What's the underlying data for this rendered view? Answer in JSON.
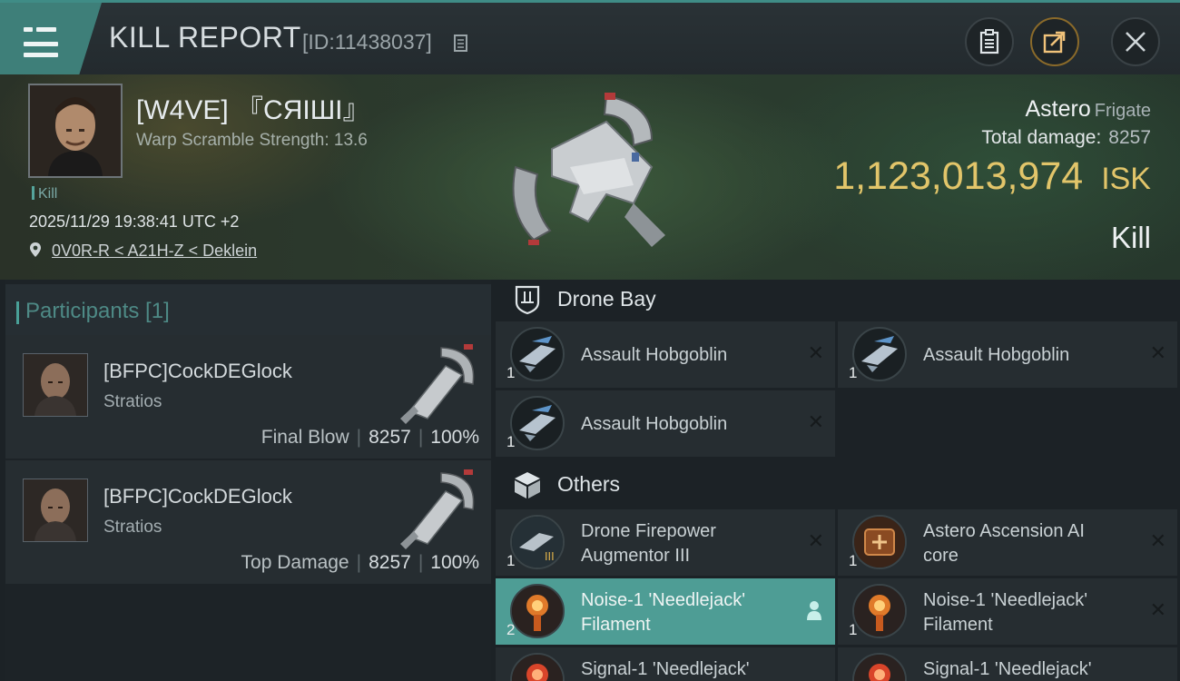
{
  "header": {
    "title": "KILL REPORT",
    "report_id": "[ID:11438037]",
    "icons": [
      "menu-icon",
      "copy-icon",
      "clipboard-icon",
      "share-icon",
      "close-icon"
    ]
  },
  "victim": {
    "pilot_name": "[W4VE] 『CЯIШI』",
    "warp_scramble": "Warp Scramble Strength: 13.6",
    "kill_tag": "Kill",
    "datetime": "2025/11/29 19:38:41 UTC +2",
    "location": "0V0R-R < A21H-Z < Deklein",
    "ship_name": "Astero",
    "ship_class": "Frigate",
    "total_damage_label": "Total damage:",
    "total_damage_value": "8257",
    "isk_value": "1,123,013,974",
    "isk_unit": "ISK",
    "result": "Kill"
  },
  "participants": {
    "label": "Participants [1]",
    "rows": [
      {
        "name": "[BFPC]CockDEGlock",
        "ship": "Stratios",
        "role": "Final Blow",
        "damage": "8257",
        "percent": "100%"
      },
      {
        "name": "[BFPC]CockDEGlock",
        "ship": "Stratios",
        "role": "Top Damage",
        "damage": "8257",
        "percent": "100%"
      }
    ]
  },
  "drone_bay": {
    "label": "Drone Bay",
    "items": [
      {
        "name": "Assault Hobgoblin",
        "qty": "1"
      },
      {
        "name": "Assault Hobgoblin",
        "qty": "1"
      },
      {
        "name": "Assault Hobgoblin",
        "qty": "1"
      }
    ]
  },
  "others": {
    "label": "Others",
    "items": [
      {
        "name_line1": "Drone Firepower",
        "name_line2": "Augmentor III",
        "qty": "1"
      },
      {
        "name_line1": "Astero Ascension AI",
        "name_line2": "core",
        "qty": "1"
      },
      {
        "name_line1": "Noise-1 'Needlejack'",
        "name_line2": "Filament",
        "qty": "2"
      },
      {
        "name_line1": "Noise-1 'Needlejack'",
        "name_line2": "Filament",
        "qty": "1"
      },
      {
        "name_line1": "Signal-1 'Needlejack'",
        "qty": ""
      },
      {
        "name_line1": "Signal-1 'Needlejack'",
        "qty": ""
      }
    ]
  },
  "colors": {
    "accent": "#3e7f79",
    "isk_gold": "#e2c56a",
    "highlight_row": "#4e9d95"
  }
}
